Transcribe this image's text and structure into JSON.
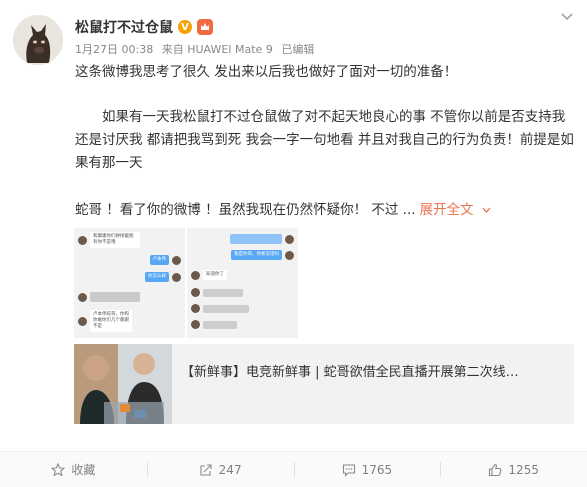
{
  "post": {
    "username": "松鼠打不过仓鼠",
    "verified_badge": "V",
    "date": "1月27日 00:38",
    "source": "来自 HUAWEI Mate 9",
    "edited": "已编辑",
    "paragraph1": "这条微博我思考了很久 发出来以后我也做好了面对一切的准备！",
    "paragraph2": "如果有一天我松鼠打不过仓鼠做了对不起天地良心的事 不管你以前是否支持我 还是讨厌我 都请把我骂到死 我会一字一句地看 并且对我自己的行为负责！前提是如果有那一天",
    "paragraph3": "蛇哥 ！看了你的微博 ！虽然我现在仍然怀疑你！ 不过 ...",
    "expand_label": "展开全文"
  },
  "images": {
    "img1": {
      "msg1": "和康康你们拼接截图有你不是哦",
      "msg2": "卢本伟",
      "msg3": "你怎么样",
      "msg4": "卢本伟蛇哥，你和你敢你们几个都跟不是"
    },
    "img2": {
      "msg1": "知道你了",
      "msg2": "我是你哥，你要说话吗"
    }
  },
  "link_card": {
    "title": "【新鲜事】电竞新鲜事 | 蛇哥欲借全民直播开展第二次线…"
  },
  "footer": {
    "favorite": "收藏",
    "repost": "247",
    "comment": "1765",
    "like": "1255"
  },
  "colors": {
    "accent": "#eb7350",
    "verified": "#f5a100",
    "chat_blue": "#56a7f5"
  }
}
